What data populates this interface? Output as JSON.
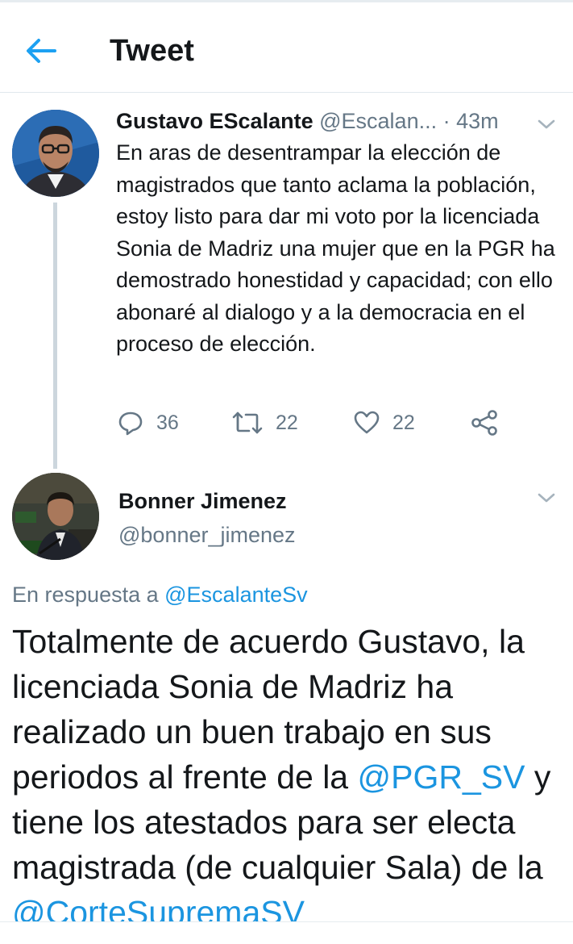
{
  "header": {
    "title": "Tweet",
    "back_icon": "back-arrow-icon"
  },
  "tweet": {
    "author_name": "Gustavo EScalante",
    "author_handle": "@Escalan...",
    "time": "· 43m",
    "text": "En aras de desentrampar la elección de magistrados que tanto aclama la población, estoy listo para dar mi voto por la licenciada Sonia de Madriz una mujer que en la PGR ha demostrado honestidad y capacidad; con ello abonaré al dialogo y a la democracia en el proceso de elección.",
    "replies": "36",
    "retweets": "22",
    "likes": "22"
  },
  "reply": {
    "author_name": "Bonner Jimenez",
    "author_handle": "@bonner_jimenez",
    "in_reply_prefix": "En respuesta a",
    "in_reply_handle": "@EscalanteSv",
    "text_part1": "Totalmente de acuerdo Gustavo, la licenciada Sonia de Madriz ha realizado un buen trabajo en sus periodos al frente de la",
    "mention1": "@PGR_SV",
    "text_part2": "y tiene los atestados para ser electa magistrada (de cualquier Sala) de la",
    "mention2": "@CorteSupremaSV"
  },
  "colors": {
    "accent": "#1da1f2",
    "link": "#1b95e0",
    "muted": "#657786",
    "text": "#14171a"
  }
}
